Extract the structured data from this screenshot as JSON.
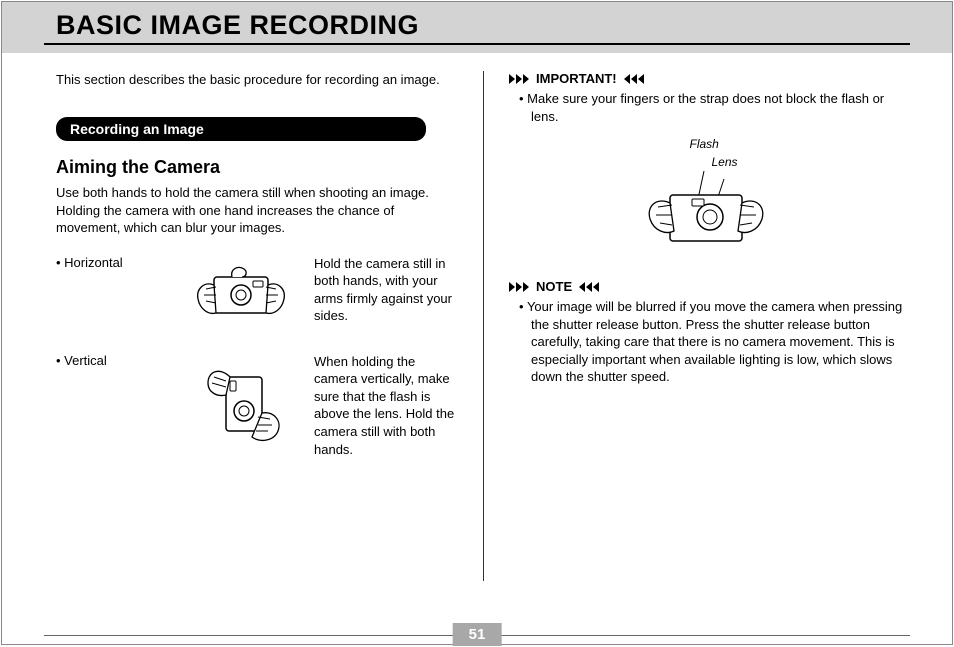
{
  "title": "BASIC IMAGE RECORDING",
  "intro": "This section describes the basic procedure for recording an image.",
  "section_label": "Recording an Image",
  "subheading": "Aiming the Camera",
  "aiming_para": "Use both hands to hold the camera still when shooting an image. Holding the camera with one hand increases the chance of movement, which can blur your images.",
  "grips": {
    "horizontal": {
      "label": "• Horizontal",
      "desc": "Hold the camera still in both hands, with your arms firmly against your sides."
    },
    "vertical": {
      "label": "• Vertical",
      "desc": "When holding the camera vertically, make sure that the flash is above the lens. Hold the camera still with both hands."
    }
  },
  "important": {
    "heading": "IMPORTANT!",
    "bullet": "Make sure your fingers or the strap does not block the flash or lens.",
    "flash_label": "Flash",
    "lens_label": "Lens"
  },
  "note": {
    "heading": "NOTE",
    "bullet": "Your image will be blurred if you move the camera when pressing the shutter release button. Press the shutter release button carefully, taking care that there is no camera movement. This is especially important when available lighting is low, which slows down the shutter speed."
  },
  "page_number": "51"
}
